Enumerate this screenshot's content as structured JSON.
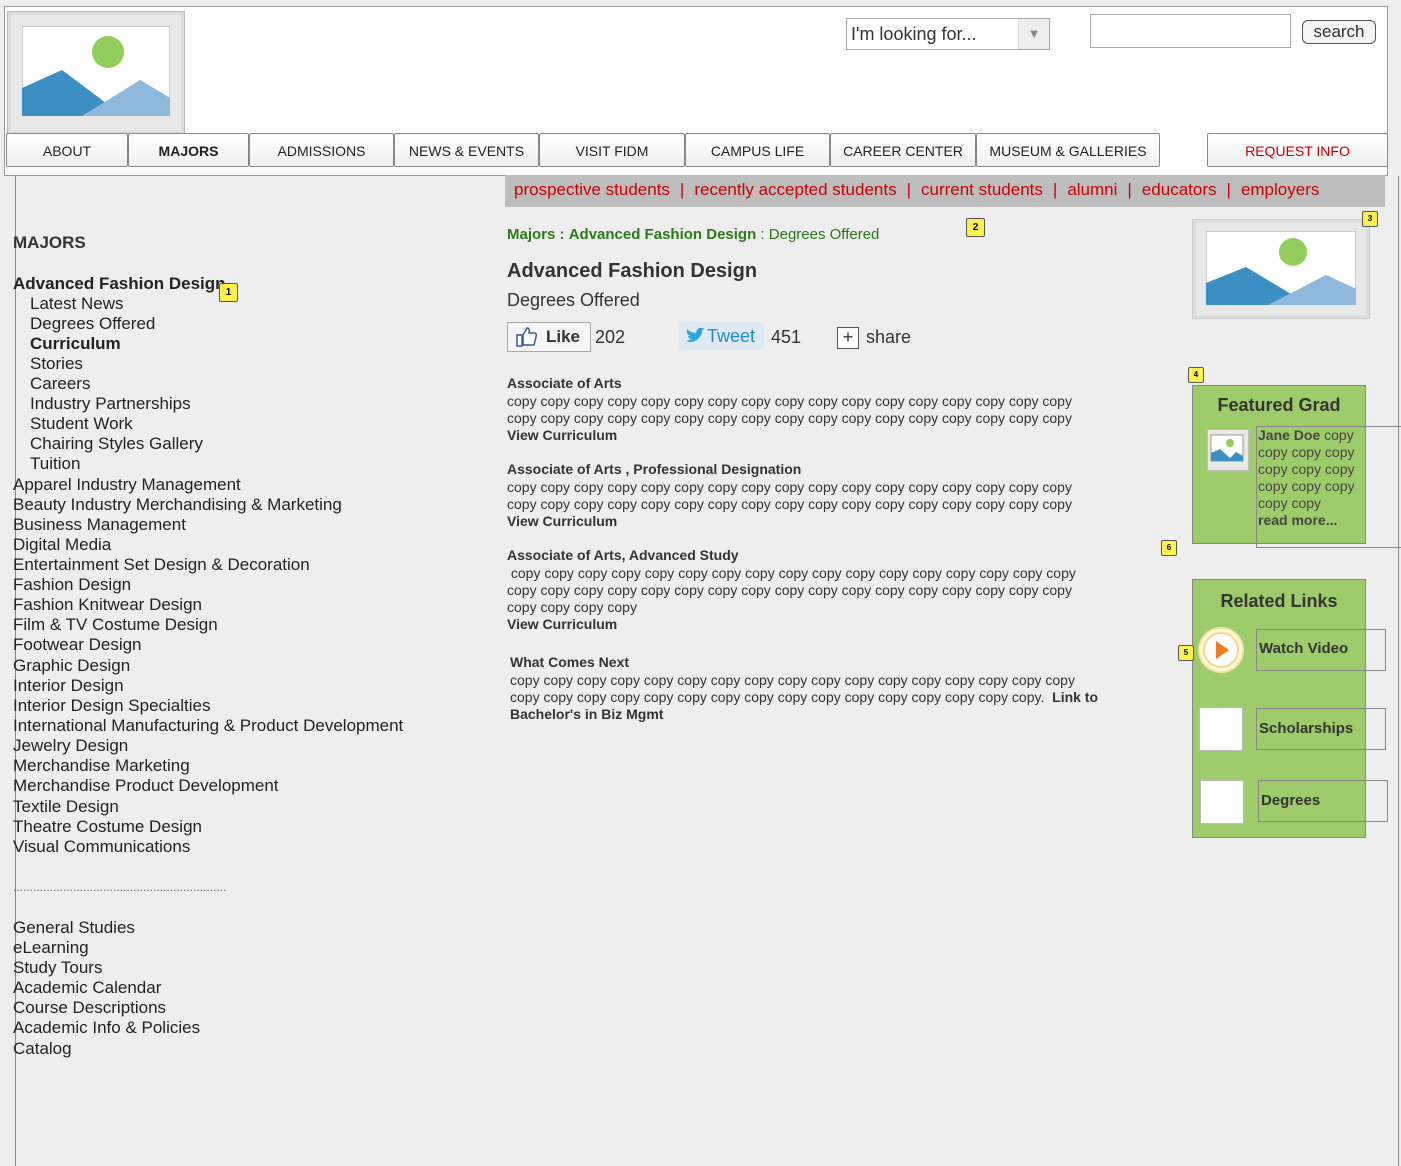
{
  "header": {
    "looking_for": "I'm looking for...",
    "search_button": "search"
  },
  "nav": {
    "items": [
      "ABOUT",
      "MAJORS",
      "ADMISSIONS",
      "NEWS & EVENTS",
      "VISIT FIDM",
      "CAMPUS LIFE",
      "CAREER CENTER",
      "MUSEUM & GALLERIES"
    ],
    "request_info": "REQUEST INFO"
  },
  "audience": [
    "prospective students",
    "recently accepted students",
    "current students",
    "alumni",
    "educators",
    "employers"
  ],
  "audience_separator": "|",
  "sidebar": {
    "title": "MAJORS",
    "current_major": "Advanced Fashion Design",
    "sub_items": [
      "Latest News",
      "Degrees Offered",
      "Curriculum",
      "Stories",
      "Careers",
      "Industry Partnerships",
      "Student Work",
      "Chairing Styles Gallery",
      "Tuition"
    ],
    "majors": [
      "Apparel Industry Management",
      "Beauty Industry Merchandising & Marketing",
      "Business Management",
      "Digital Media",
      "Entertainment Set Design & Decoration",
      "Fashion Design",
      "Fashion Knitwear Design",
      "Film & TV Costume Design",
      "Footwear Design",
      "Graphic Design",
      "Interior Design",
      "Interior Design Specialties",
      "International Manufacturing & Product Development",
      "Jewelry Design",
      "Merchandise Marketing",
      "Merchandise Product Development",
      "Textile Design",
      "Theatre Costume Design",
      "Visual Communications"
    ],
    "divider": "................................................................",
    "other": [
      "General Studies",
      "eLearning",
      "Study Tours",
      "Academic Calendar",
      "Course Descriptions",
      "Academic Info & Policies",
      "Catalog"
    ]
  },
  "badges": [
    "1",
    "2",
    "3",
    "4",
    "5",
    "6"
  ],
  "breadcrumb": {
    "part1": "Majors",
    "sep": ":",
    "part2": "Advanced Fashion Design",
    "part3": "Degrees Offered"
  },
  "main": {
    "title": "Advanced Fashion Design",
    "subtitle": "Degrees Offered",
    "like_label": "Like",
    "like_count": "202",
    "tweet_label": "Tweet",
    "tweet_count": "451",
    "share_icon": "+",
    "share_label": "share",
    "sections": [
      {
        "title": "Associate of Arts",
        "lines": [
          "copy copy copy copy copy copy copy copy copy copy copy copy copy copy copy copy copy",
          "copy copy copy copy copy copy copy copy copy copy copy copy copy copy copy copy copy"
        ],
        "link": "View Curriculum"
      },
      {
        "title": "Associate of Arts , Professional Designation",
        "lines": [
          "copy copy copy copy copy copy copy copy copy copy copy copy copy copy copy copy copy",
          "copy copy copy copy copy copy copy copy copy copy copy copy copy copy copy copy copy"
        ],
        "link": "View Curriculum"
      },
      {
        "title": "Associate of Arts, Advanced Study",
        "lines": [
          " copy copy copy copy copy copy copy copy copy copy copy copy copy copy copy copy copy",
          "copy copy copy copy copy copy copy copy copy copy copy copy copy copy copy copy copy",
          "copy copy copy copy"
        ],
        "link": "View Curriculum"
      }
    ],
    "next": {
      "title": "What Comes Next",
      "line1": "copy copy copy copy copy copy copy copy copy copy copy copy copy copy copy copy copy",
      "line2": "copy copy copy copy copy copy copy copy copy copy copy copy copy copy copy copy.",
      "link_a": "Link to",
      "link_b": "Bachelor's in Biz Mgmt"
    }
  },
  "featured": {
    "title": "Featured Grad",
    "name": "Jane Doe",
    "lines": [
      "copy",
      "copy copy copy",
      "copy copy copy",
      "copy copy copy",
      "copy copy"
    ],
    "read_more": "read more..."
  },
  "related": {
    "title": "Related Links",
    "items": [
      "Watch Video",
      "Scholarships",
      "Degrees"
    ]
  },
  "colors": {
    "accent_red": "#cc0000",
    "breadcrumb_green": "#2a7a16",
    "panel_green": "#9dcc6a",
    "audience_bar": "#bdbdbd",
    "badge_yellow": "#fff24a"
  }
}
